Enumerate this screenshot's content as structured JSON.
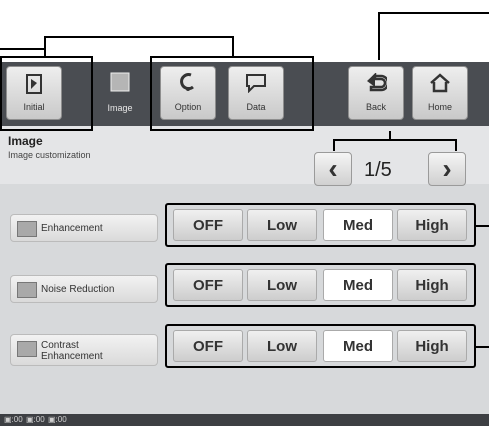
{
  "toolbar": {
    "initial_label": "Initial",
    "image_label": "Image",
    "option_label": "Option",
    "data_label": "Data",
    "back_label": "Back",
    "home_label": "Home"
  },
  "page": {
    "title": "Image",
    "subtitle": "Image customization",
    "pager": "1/5"
  },
  "rows": [
    {
      "label": "Enhancement",
      "options": [
        "OFF",
        "Low",
        "Med",
        "High"
      ],
      "selected": "Med"
    },
    {
      "label": "Noise Reduction",
      "options": [
        "OFF",
        "Low",
        "Med",
        "High"
      ],
      "selected": "Med"
    },
    {
      "label": "Contrast Enhancement",
      "options": [
        "OFF",
        "Low",
        "Med",
        "High"
      ],
      "selected": "Med"
    }
  ],
  "statusbar": {
    "items": [
      "▣:00",
      "▣:00",
      "▣:00"
    ]
  },
  "icons": {
    "pager_prev": "chevron-left-icon",
    "pager_next": "chevron-right-icon"
  }
}
